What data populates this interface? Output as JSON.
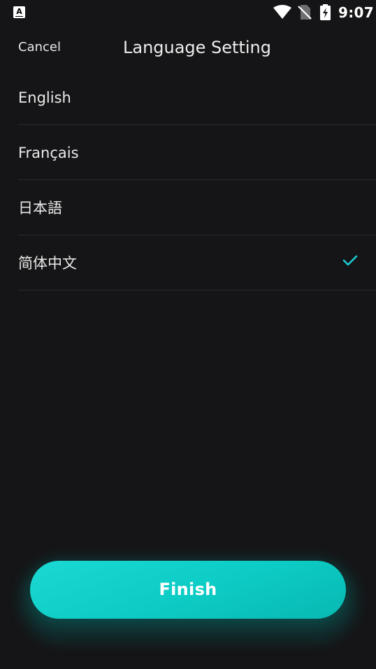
{
  "status_bar": {
    "app_icon_letter": "A",
    "time": "9:07",
    "icons": [
      "app-notification-icon",
      "wifi-icon",
      "no-sim-icon",
      "battery-charging-icon"
    ]
  },
  "header": {
    "cancel_label": "Cancel",
    "title": "Language Setting"
  },
  "languages": [
    {
      "label": "English",
      "selected": false
    },
    {
      "label": "Français",
      "selected": false
    },
    {
      "label": "日本語",
      "selected": false
    },
    {
      "label": "简体中文",
      "selected": true
    }
  ],
  "finish_label": "Finish",
  "colors": {
    "background": "#151517",
    "accent": "#0ccbc4",
    "check": "#1cc9d2",
    "divider": "#2b2b2e"
  }
}
